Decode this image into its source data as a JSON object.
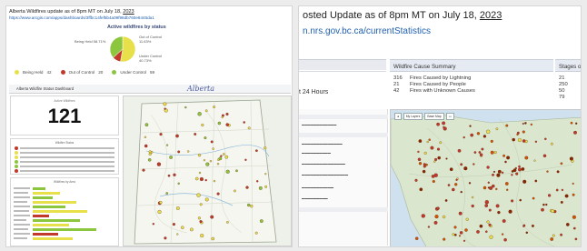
{
  "alberta": {
    "title_prefix": "Alberta Wildfires update as of 8pm MT on July 18,",
    "title_year": "2023",
    "url": "https://www.arcgis.com/apps/dashboards/3ffbc14fef5b4a09f98db760e8445da1",
    "pie": {
      "title": "Active wildfires by status",
      "labels": [
        "Being Held 58.71%",
        "Out of Control 11.63%",
        "Under Control 40.73%"
      ],
      "slices": [
        {
          "name": "Being Held",
          "value": 58.71,
          "color": "#e8e04a"
        },
        {
          "name": "Out of Control",
          "value": 11.63,
          "color": "#c0392b"
        },
        {
          "name": "Under Control",
          "value": 40.73,
          "color": "#8cc63f"
        }
      ]
    },
    "legend": [
      {
        "label": "Being Held",
        "value": "42",
        "color": "#e8e04a"
      },
      {
        "label": "Out of Control",
        "value": "20",
        "color": "#c0392b"
      },
      {
        "label": "Under Control",
        "value": "59",
        "color": "#8cc63f"
      }
    ],
    "dashboard_title": "Alberta Wildfire Status Dashboard",
    "logo_text": "Alberta",
    "count_label": "Active Wildfires",
    "count": "121",
    "list_header": "Wildfire Status",
    "bars_header": "Wildfires by Area"
  },
  "bc": {
    "title_prefix": "osted Update as of 8pm MT on July 18,",
    "title_year": "2023",
    "url": "n.nrs.gov.bc.ca/currentStatistics",
    "last24": "t 24 Hours",
    "cause_header": "Wildfire Cause Summary",
    "stage_header": "Stages o",
    "causes": [
      {
        "num": "316",
        "label": "Fires Caused by Lightning"
      },
      {
        "num": "21",
        "label": "Fires Caused by People"
      },
      {
        "num": "42",
        "label": "Fires with Unknown Causes"
      }
    ],
    "stages": [
      "21",
      "250",
      "50",
      "79"
    ],
    "map_buttons": [
      "My Layers",
      "Base Map"
    ]
  }
}
